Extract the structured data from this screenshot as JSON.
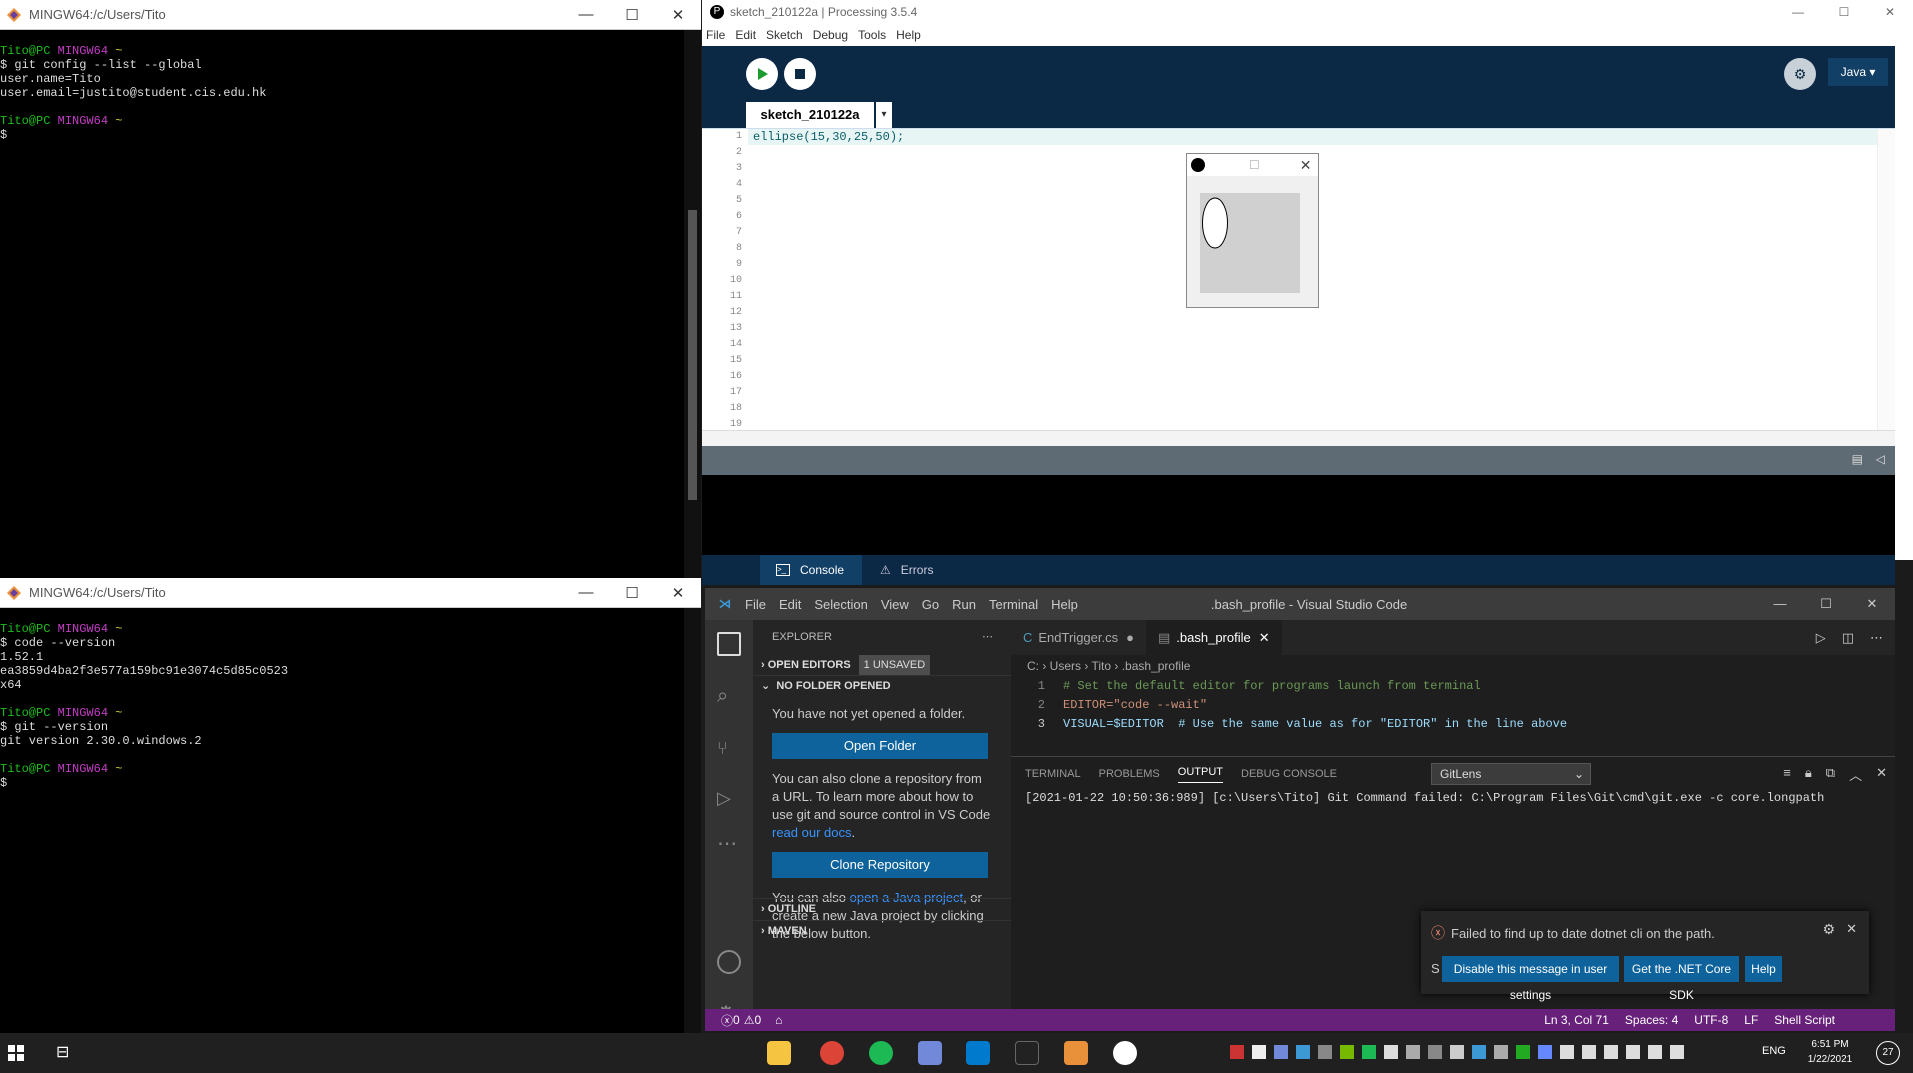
{
  "terminal_top": {
    "title": "MINGW64:/c/Users/Tito",
    "lines": [
      {
        "user": "Tito@PC",
        "host": "MINGW64",
        "path": "~"
      },
      {
        "text": "$ git config --list --global"
      },
      {
        "text": "user.name=Tito"
      },
      {
        "text": "user.email=justito@student.cis.edu.hk"
      },
      {
        "text": ""
      },
      {
        "user": "Tito@PC",
        "host": "MINGW64",
        "path": "~"
      },
      {
        "text": "$ "
      }
    ]
  },
  "terminal_bottom": {
    "title": "MINGW64:/c/Users/Tito",
    "lines": [
      {
        "user": "Tito@PC",
        "host": "MINGW64",
        "path": "~"
      },
      {
        "text": "$ code --version"
      },
      {
        "text": "1.52.1"
      },
      {
        "text": "ea3859d4ba2f3e577a159bc91e3074c5d85c0523"
      },
      {
        "text": "x64"
      },
      {
        "text": ""
      },
      {
        "user": "Tito@PC",
        "host": "MINGW64",
        "path": "~"
      },
      {
        "text": "$ git --version"
      },
      {
        "text": "git version 2.30.0.windows.2"
      },
      {
        "text": ""
      },
      {
        "user": "Tito@PC",
        "host": "MINGW64",
        "path": "~"
      },
      {
        "text": "$ "
      }
    ]
  },
  "processing": {
    "title": "sketch_210122a | Processing 3.5.4",
    "menu": [
      "File",
      "Edit",
      "Sketch",
      "Debug",
      "Tools",
      "Help"
    ],
    "mode": "Java",
    "tab": "sketch_210122a",
    "code_line": "ellipse(15,30,25,50);",
    "line_numbers": [
      "1",
      "2",
      "3",
      "4",
      "5",
      "6",
      "7",
      "8",
      "9",
      "10",
      "11",
      "12",
      "13",
      "14",
      "15",
      "16",
      "17",
      "18",
      "19"
    ],
    "console_tab": "Console",
    "errors_tab": "Errors"
  },
  "vscode": {
    "title": ".bash_profile - Visual Studio Code",
    "menu": [
      "File",
      "Edit",
      "Selection",
      "View",
      "Go",
      "Run",
      "Terminal",
      "Help"
    ],
    "explorer": "EXPLORER",
    "open_editors": "OPEN EDITORS",
    "unsaved": "1 UNSAVED",
    "no_folder": "NO FOLDER OPENED",
    "no_folder_msg": "You have not yet opened a folder.",
    "open_folder": "Open Folder",
    "clone_msg": "You can also clone a repository from a URL. To learn more about how to use git and source control in VS Code",
    "read_docs": "read our docs",
    "clone_repo": "Clone Repository",
    "java_msg_a": "You can also",
    "java_link": "open a Java project",
    "java_msg_b": ", or create a new Java project by clicking the below button.",
    "outline": "OUTLINE",
    "maven": "MAVEN",
    "tab1": "EndTrigger.cs",
    "tab2": ".bash_profile",
    "breadcrumb": [
      "C:",
      "Users",
      "Tito",
      ".bash_profile"
    ],
    "code": [
      {
        "n": "1",
        "text": "# Set the default editor for programs launch from terminal"
      },
      {
        "n": "2",
        "text": "EDITOR=\"code --wait\""
      },
      {
        "n": "3",
        "text": "VISUAL=$EDITOR  # Use the same value as for \"EDITOR\" in the line above"
      }
    ],
    "panel_tabs": [
      "TERMINAL",
      "PROBLEMS",
      "OUTPUT",
      "DEBUG CONSOLE"
    ],
    "output_channel": "GitLens",
    "output_line": "[2021-01-22 10:50:36:989] [c:\\Users\\Tito] Git Command failed: C:\\Program Files\\Git\\cmd\\git.exe -c core.longpath",
    "notif_msg": "Failed to find up to date dotnet cli on the path.",
    "notif_s": "S",
    "notif_btn1": "Disable this message in user settings",
    "notif_btn2": "Get the .NET Core SDK",
    "notif_btn3": "Help",
    "status_errors": "0",
    "status_warnings": "0",
    "status_right": [
      "Ln 3, Col 71",
      "Spaces: 4",
      "UTF-8",
      "LF",
      "Shell Script"
    ]
  },
  "taskbar": {
    "lang": "ENG",
    "time": "6:51 PM",
    "date": "1/22/2021",
    "badge": "27"
  }
}
